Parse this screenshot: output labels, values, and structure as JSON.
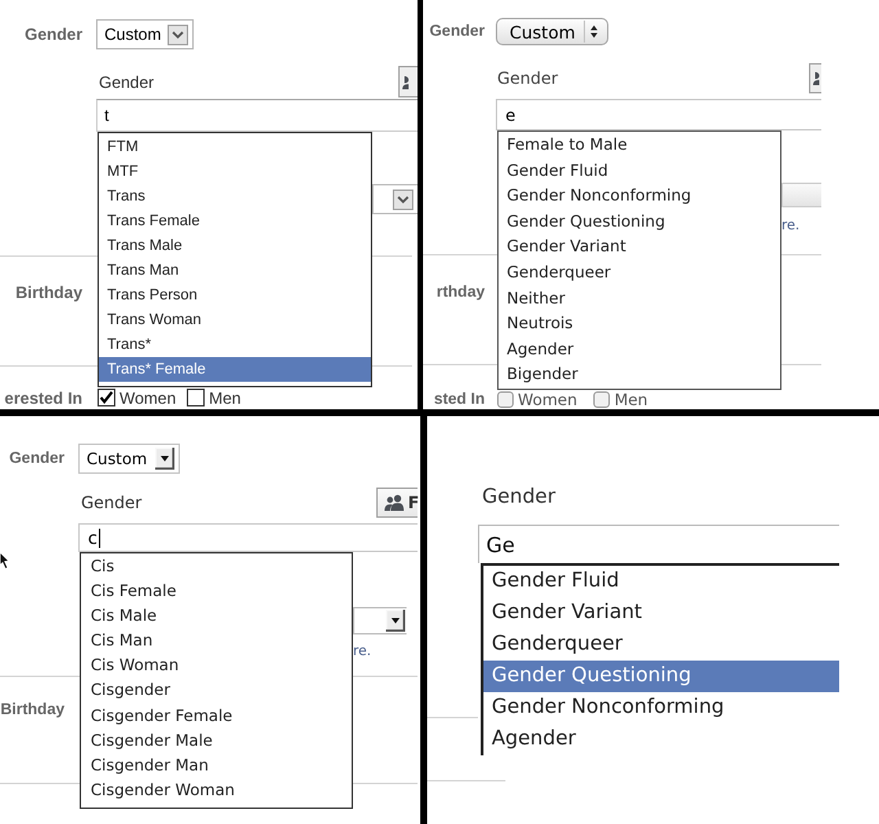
{
  "panels": [
    {
      "kind": "windows-form",
      "row_label": "Gender",
      "select": {
        "value": "Custom"
      },
      "field_label": "Gender",
      "query": {
        "value": "t"
      },
      "suggestions": [
        {
          "label": "FTM",
          "selected": false
        },
        {
          "label": "MTF",
          "selected": false
        },
        {
          "label": "Trans",
          "selected": false
        },
        {
          "label": "Trans Female",
          "selected": false
        },
        {
          "label": "Trans Male",
          "selected": false
        },
        {
          "label": "Trans Man",
          "selected": false
        },
        {
          "label": "Trans Person",
          "selected": false
        },
        {
          "label": "Trans Woman",
          "selected": false
        },
        {
          "label": "Trans*",
          "selected": false
        },
        {
          "label": "Trans* Female",
          "selected": true
        }
      ],
      "birthday_label": "Birthday",
      "interest_label": "erested In",
      "interest_options": [
        {
          "label": "Women",
          "checked": true
        },
        {
          "label": "Men",
          "checked": false
        }
      ]
    },
    {
      "kind": "mac-form",
      "row_label": "Gender",
      "select": {
        "value": "Custom"
      },
      "field_label": "Gender",
      "query": {
        "value": "e"
      },
      "suggestions": [
        {
          "label": "Female to Male",
          "selected": false
        },
        {
          "label": "Gender Fluid",
          "selected": false
        },
        {
          "label": "Gender Nonconforming",
          "selected": false
        },
        {
          "label": "Gender Questioning",
          "selected": false
        },
        {
          "label": "Gender Variant",
          "selected": false
        },
        {
          "label": "Genderqueer",
          "selected": false
        },
        {
          "label": "Neither",
          "selected": false
        },
        {
          "label": "Neutrois",
          "selected": false
        },
        {
          "label": "Agender",
          "selected": false
        },
        {
          "label": "Bigender",
          "selected": false
        }
      ],
      "note": "re.",
      "birthday_label": "rthday",
      "interest_label": "sted In",
      "interest_options": [
        {
          "label": "Women",
          "checked": false
        },
        {
          "label": "Men",
          "checked": false
        }
      ]
    },
    {
      "kind": "classic-form",
      "row_label": "Gender",
      "select": {
        "value": "Custom"
      },
      "field_label": "Gender",
      "share_button": {
        "label": "F"
      },
      "mouse_pointer": true,
      "query": {
        "value": "c",
        "caret": true
      },
      "suggestions": [
        {
          "label": "Cis",
          "selected": false
        },
        {
          "label": "Cis Female",
          "selected": false
        },
        {
          "label": "Cis Male",
          "selected": false
        },
        {
          "label": "Cis Man",
          "selected": false
        },
        {
          "label": "Cis Woman",
          "selected": false
        },
        {
          "label": "Cisgender",
          "selected": false
        },
        {
          "label": "Cisgender Female",
          "selected": false
        },
        {
          "label": "Cisgender Male",
          "selected": false
        },
        {
          "label": "Cisgender Man",
          "selected": false
        },
        {
          "label": "Cisgender Woman",
          "selected": false
        }
      ],
      "note": "re.",
      "birthday_label": "Birthday"
    },
    {
      "kind": "zoomed-field",
      "field_label": "Gender",
      "query": {
        "value": "Ge"
      },
      "suggestions": [
        {
          "label": "Gender Fluid",
          "selected": false
        },
        {
          "label": "Gender Variant",
          "selected": false
        },
        {
          "label": "Genderqueer",
          "selected": false
        },
        {
          "label": "Gender Questioning",
          "selected": true
        },
        {
          "label": "Gender Nonconforming",
          "selected": false
        },
        {
          "label": "Agender",
          "selected": false
        }
      ]
    }
  ]
}
